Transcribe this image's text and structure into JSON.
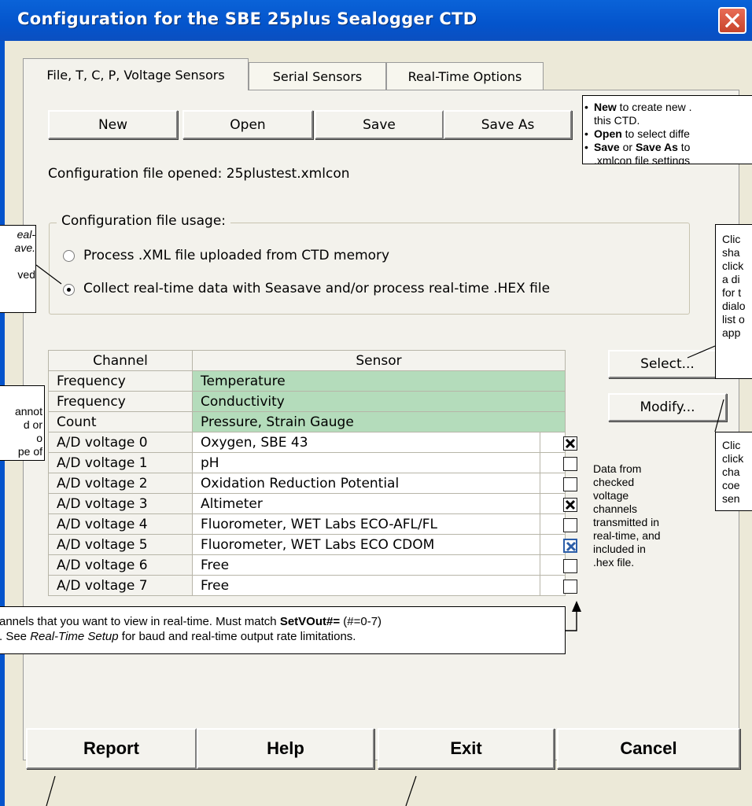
{
  "window": {
    "title": "Configuration for the SBE 25plus Sealogger CTD"
  },
  "tabs": [
    {
      "label": "File, T, C, P, Voltage Sensors"
    },
    {
      "label": "Serial Sensors"
    },
    {
      "label": "Real-Time Options"
    }
  ],
  "file_buttons": {
    "new": "New",
    "open": "Open",
    "save": "Save",
    "save_as": "Save As"
  },
  "config_file": {
    "label": "Configuration file opened:",
    "name": "25plustest.xmlcon"
  },
  "usage": {
    "legend": "Configuration file usage:",
    "options": [
      "Process .XML file uploaded from CTD memory",
      "Collect real-time data with Seasave and/or process real-time .HEX file"
    ],
    "selected_index": 1
  },
  "sensor_table": {
    "headers": [
      "Channel",
      "Sensor"
    ],
    "rows": [
      {
        "channel": "Frequency",
        "sensor": "Temperature",
        "fixed": true
      },
      {
        "channel": "Frequency",
        "sensor": "Conductivity",
        "fixed": true
      },
      {
        "channel": "Count",
        "sensor": "Pressure, Strain Gauge",
        "fixed": true
      },
      {
        "channel": "A/D voltage 0",
        "sensor": "Oxygen, SBE 43",
        "checked": true
      },
      {
        "channel": "A/D voltage 1",
        "sensor": "pH",
        "checked": false
      },
      {
        "channel": "A/D voltage 2",
        "sensor": "Oxidation Reduction Potential",
        "checked": false
      },
      {
        "channel": "A/D voltage 3",
        "sensor": "Altimeter",
        "checked": true
      },
      {
        "channel": "A/D voltage 4",
        "sensor": "Fluorometer, WET Labs ECO-AFL/FL",
        "checked": false
      },
      {
        "channel": "A/D voltage 5",
        "sensor": "Fluorometer, WET Labs ECO CDOM",
        "checked": true
      },
      {
        "channel": "A/D voltage 6",
        "sensor": "Free",
        "checked": false
      },
      {
        "channel": "A/D voltage 7",
        "sensor": "Free",
        "checked": false
      }
    ]
  },
  "side_buttons": {
    "select": "Select...",
    "modify": "Modify..."
  },
  "voltage_note": [
    "Data from",
    "checked",
    "voltage",
    "channels",
    "transmitted in",
    "real-time, and",
    "included in",
    ".hex file."
  ],
  "bottom_buttons": {
    "report": "Report",
    "help": "Help",
    "exit": "Exit",
    "cancel": "Cancel"
  },
  "callouts": {
    "file_ops": {
      "line1_bold": "New",
      "line1_rest": " to create new .",
      "line2": "this CTD.",
      "line3_bold": "Open",
      "line3_rest": " to select diffe",
      "line4_bold": "Save",
      "line4_mid": " or ",
      "line4_bold2": "Save As",
      "line4_rest": " to",
      "line5": ".xmlcon file settings"
    },
    "usage_left": {
      "lines": [
        "eal-",
        "ave.",
        "",
        "ved"
      ]
    },
    "table_left": {
      "lines": [
        "annot",
        "d or",
        "o",
        "pe of"
      ]
    },
    "select_right": {
      "lines": [
        "Clic",
        "sha",
        "click",
        "a di",
        "for t",
        "dialo",
        "list o",
        "app"
      ]
    },
    "modify_right": {
      "lines": [
        "Clic",
        "click",
        "cha",
        "coe",
        "sen"
      ]
    },
    "bottom": {
      "line1_a": "annels that you want to view in real-time. Must match ",
      "line1_bold": "SetVOut#=",
      "line1_b": " (#=0-7)",
      "line2_a": ". See ",
      "line2_italic": "Real-Time Setup",
      "line2_b": " for baud and real-time output rate limitations."
    }
  }
}
